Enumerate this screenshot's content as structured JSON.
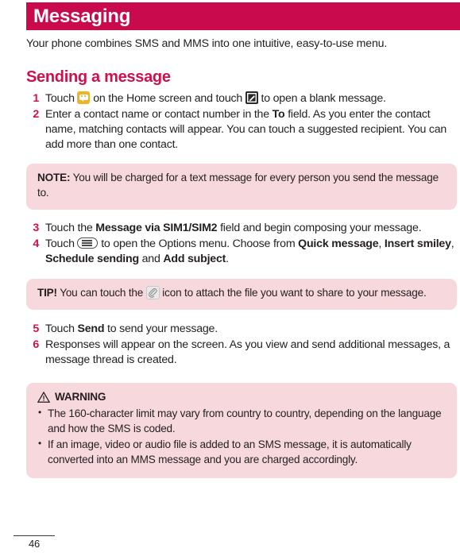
{
  "header": {
    "title": "Messaging",
    "bar_color": "#c90b4e"
  },
  "intro": "Your phone combines SMS and MMS into one intuitive, easy-to-use menu.",
  "section": {
    "heading": "Sending a message",
    "heading_color": "#d0104c"
  },
  "steps_group_1": [
    {
      "num": "1",
      "parts": [
        {
          "t": "text",
          "v": "Touch "
        },
        {
          "t": "icon",
          "v": "messaging-app-icon"
        },
        {
          "t": "text",
          "v": " on the Home screen and touch "
        },
        {
          "t": "icon",
          "v": "compose-message-icon"
        },
        {
          "t": "text",
          "v": " to open a blank message."
        }
      ],
      "pre": "Touch ",
      "mid": " on the Home screen and touch ",
      "post": " to open a blank message."
    },
    {
      "num": "2",
      "pre": "Enter a contact name or contact number in the ",
      "bold": "To",
      "post": " field. As you enter the contact name, matching contacts will appear. You can touch a suggested recipient. You can add more than one contact."
    }
  ],
  "note": {
    "label": "NOTE:",
    "text": " You will be charged for a text message for every person you send the message to."
  },
  "steps_group_2": [
    {
      "num": "3",
      "pre": "Touch the ",
      "bold": "Message via SIM1/SIM2",
      "post": " field and begin composing your message."
    },
    {
      "num": "4",
      "pre": "Touch ",
      "mid": " to open the Options menu. Choose from ",
      "bold1": "Quick message",
      "sep1": ", ",
      "bold2": "Insert smiley",
      "sep2": ", ",
      "bold3": "Schedule sending",
      "sep3": " and ",
      "bold4": "Add subject",
      "post": "."
    }
  ],
  "tip": {
    "label": "TIP!",
    "pre": " You can touch the ",
    "post": " icon to attach the file you want to share to your message."
  },
  "steps_group_3": [
    {
      "num": "5",
      "pre": "Touch ",
      "bold": "Send",
      "post": " to send your message."
    },
    {
      "num": "6",
      "pre": "Responses will appear on the screen. As you view and send additional messages, a message thread is created."
    }
  ],
  "warning": {
    "title": "WARNING",
    "bullets": [
      "The 160-character limit may vary from country to country, depending on the language and how the SMS is coded.",
      "If an image, video or audio file is added to an SMS message, it is automatically converted into an MMS message and you are charged accordingly."
    ]
  },
  "footer": {
    "page_number": "46"
  },
  "colors": {
    "accent": "#d0104c",
    "header_bar": "#c90b4e",
    "callout_bg": "#f7d9dd",
    "body_text": "#231f20",
    "app_icon_yellow": "#f0b323",
    "compose_icon_dark": "#2b2b2b"
  }
}
